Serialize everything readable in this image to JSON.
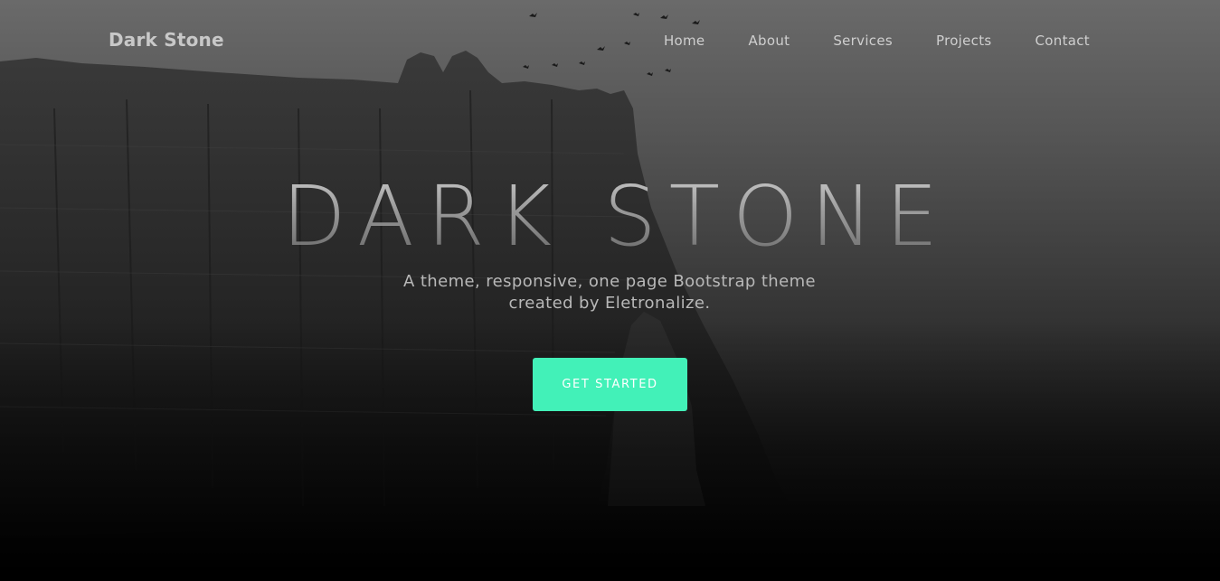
{
  "brand": {
    "name": "Dark Stone"
  },
  "nav": {
    "items": [
      {
        "label": "Home"
      },
      {
        "label": "About"
      },
      {
        "label": "Services"
      },
      {
        "label": "Projects"
      },
      {
        "label": "Contact"
      }
    ]
  },
  "hero": {
    "title": "DARK STONE",
    "subtitle": "A theme, responsive, one page Bootstrap theme created by Eletronalize.",
    "cta_label": "GET STARTED",
    "background": "cliff-arch-photo"
  },
  "colors": {
    "accent": "#42f1b8",
    "background": "#2a2a2a",
    "nav_text": "#cfcfcf"
  }
}
